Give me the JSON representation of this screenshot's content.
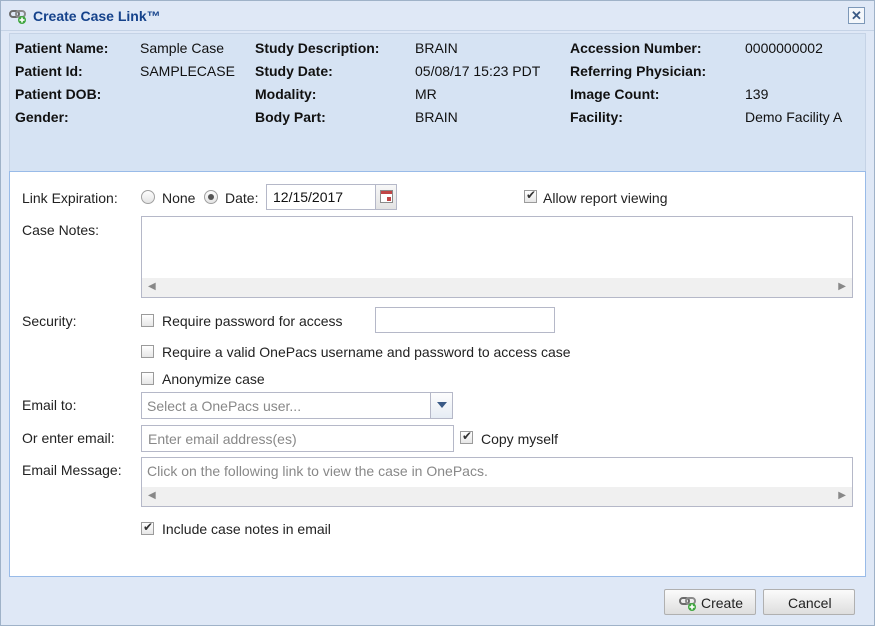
{
  "dialog": {
    "title": "Create Case Link™",
    "close_label": "✕"
  },
  "patient": {
    "name_label": "Patient Name:",
    "name": "Sample Case",
    "id_label": "Patient Id:",
    "id": "SAMPLECASE",
    "dob_label": "Patient DOB:",
    "dob": "",
    "gender_label": "Gender:",
    "gender": ""
  },
  "study": {
    "description_label": "Study Description:",
    "description": "BRAIN",
    "date_label": "Study Date:",
    "date": "05/08/17 15:23 PDT",
    "modality_label": "Modality:",
    "modality": "MR",
    "body_part_label": "Body Part:",
    "body_part": "BRAIN"
  },
  "case": {
    "accession_label": "Accession Number:",
    "accession": "0000000002",
    "referring_label": "Referring Physician:",
    "referring": "",
    "image_count_label": "Image Count:",
    "image_count": "139",
    "facility_label": "Facility:",
    "facility": "Demo Facility A"
  },
  "form": {
    "link_expiration_label": "Link Expiration:",
    "none_label": "None",
    "date_label": "Date:",
    "expiration_date": "12/15/2017",
    "expiration_mode": "date",
    "allow_report_label": "Allow report viewing",
    "allow_report_checked": true,
    "case_notes_label": "Case Notes:",
    "case_notes": "",
    "security_label": "Security:",
    "require_password_label": "Require password for access",
    "require_password_checked": false,
    "password": "",
    "require_onepacs_label": "Require a valid OnePacs username and password to access case",
    "require_onepacs_checked": false,
    "anonymize_label": "Anonymize case",
    "anonymize_checked": false,
    "email_to_label": "Email to:",
    "email_to_placeholder": "Select a OnePacs user...",
    "or_enter_email_label": "Or enter email:",
    "email_placeholder": "Enter email address(es)",
    "copy_myself_label": "Copy myself",
    "copy_myself_checked": true,
    "email_message_label": "Email Message:",
    "email_message": "Click on the following link to view the case in OnePacs.",
    "include_notes_label": "Include case notes in email",
    "include_notes_checked": true
  },
  "footer": {
    "create_label": "Create",
    "cancel_label": "Cancel"
  }
}
